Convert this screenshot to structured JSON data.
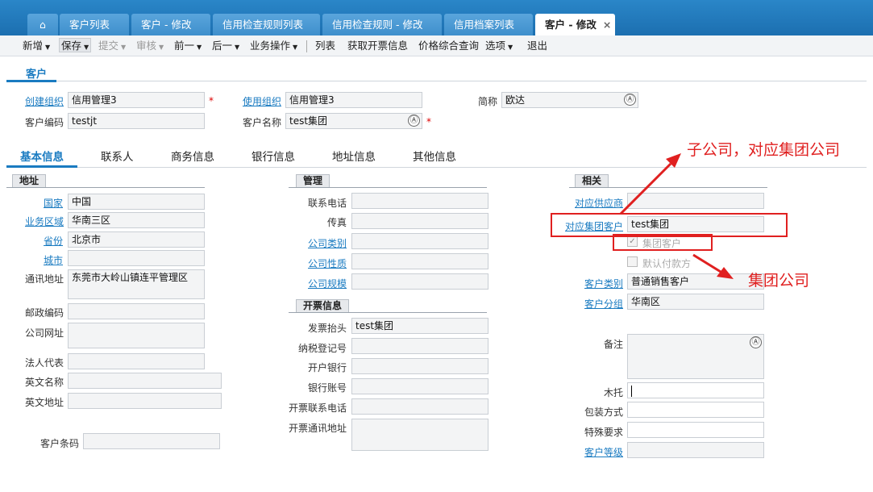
{
  "tabs": [
    {
      "label": "客户列表"
    },
    {
      "label": "客户 - 修改"
    },
    {
      "label": "信用检查规则列表"
    },
    {
      "label": "信用检查规则 - 修改"
    },
    {
      "label": "信用档案列表"
    },
    {
      "label": "客户 - 修改",
      "close": "×"
    }
  ],
  "toolbar": {
    "new": "新增",
    "save": "保存",
    "submit": "提交",
    "audit": "审核",
    "prev": "前一",
    "next": "后一",
    "bizops": "业务操作",
    "list": "列表",
    "get_invoice": "获取开票信息",
    "price_query": "价格综合查询",
    "options": "选项",
    "exit": "退出"
  },
  "section_title": "客户",
  "header": {
    "create_org_label": "创建组织",
    "create_org_value": "信用管理3",
    "use_org_label": "使用组织",
    "use_org_value": "信用管理3",
    "short_name_label": "简称",
    "short_name_value": "欧达",
    "code_label": "客户编码",
    "code_value": "testjt",
    "name_label": "客户名称",
    "name_value": "test集团",
    "required_mark": "*",
    "multilang_icon": "Ⓐ"
  },
  "subtabs": [
    "基本信息",
    "联系人",
    "商务信息",
    "银行信息",
    "地址信息",
    "其他信息"
  ],
  "address": {
    "group": "地址",
    "country_label": "国家",
    "country_value": "中国",
    "region_label": "业务区域",
    "region_value": "华南三区",
    "province_label": "省份",
    "province_value": "北京市",
    "city_label": "城市",
    "city_value": "",
    "mail_addr_label": "通讯地址",
    "mail_addr_value": "东莞市大岭山镇连平管理区",
    "zip_label": "邮政编码",
    "website_label": "公司网址",
    "legal_label": "法人代表",
    "en_name_label": "英文名称",
    "en_addr_label": "英文地址",
    "barcode_label": "客户条码"
  },
  "manage": {
    "group": "管理",
    "phone_label": "联系电话",
    "fax_label": "传真",
    "company_type_label": "公司类别",
    "company_nature_label": "公司性质",
    "company_scale_label": "公司规模"
  },
  "invoice": {
    "group": "开票信息",
    "title_label": "发票抬头",
    "title_value": "test集团",
    "tax_no_label": "纳税登记号",
    "bank_label": "开户银行",
    "account_label": "银行账号",
    "phone_label": "开票联系电话",
    "addr_label": "开票通讯地址"
  },
  "related": {
    "group": "相关",
    "supplier_label": "对应供应商",
    "group_cust_label": "对应集团客户",
    "group_cust_value": "test集团",
    "is_group_label": "集团客户",
    "default_payer_label": "默认付款方",
    "cust_type_label": "客户类别",
    "cust_type_value": "普通销售客户",
    "cust_group_label": "客户分组",
    "cust_group_value": "华南区",
    "remark_label": "备注",
    "pallet_label": "木托",
    "packing_label": "包装方式",
    "special_label": "特殊要求",
    "grade_label": "客户等级"
  },
  "annotations": {
    "sub": "子公司，对应集团公司",
    "group": "集团公司"
  },
  "colors": {
    "accent": "#1a7bc1",
    "annotation": "#e02020",
    "tabbar": "#1c6fb0"
  }
}
